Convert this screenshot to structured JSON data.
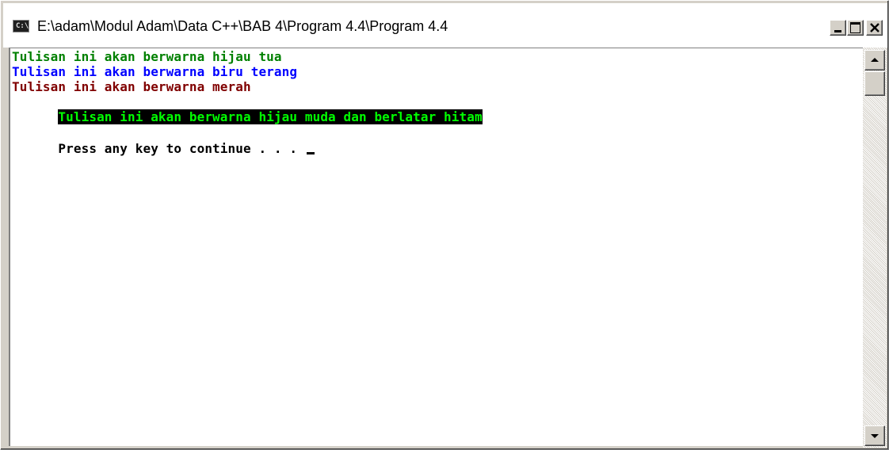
{
  "window": {
    "title": "E:\\adam\\Modul Adam\\Data C++\\BAB 4\\Program 4.4\\Program 4.4",
    "icon_text": "C:\\",
    "icon": "console-app-icon",
    "controls": {
      "minimize_icon": "minimize-icon",
      "maximize_icon": "maximize-icon",
      "close_icon": "close-icon"
    }
  },
  "console": {
    "background": "#ffffff",
    "lines": [
      {
        "text": "Tulisan ini akan berwarna hijau tua",
        "color": "#008000",
        "background": "#ffffff"
      },
      {
        "text": "Tulisan ini akan berwarna biru terang",
        "color": "#0000ff",
        "background": "#ffffff"
      },
      {
        "text": "Tulisan ini akan berwarna merah",
        "color": "#800000",
        "background": "#ffffff"
      },
      {
        "text": "Tulisan ini akan berwarna hijau muda dan berlatar hitam",
        "color": "#00ff00",
        "background": "#000000"
      }
    ],
    "prompt": {
      "text": "Press any key to continue . . . ",
      "color": "#000000"
    }
  },
  "scrollbar": {
    "up_icon": "scroll-up-arrow-icon",
    "down_icon": "scroll-down-arrow-icon"
  }
}
